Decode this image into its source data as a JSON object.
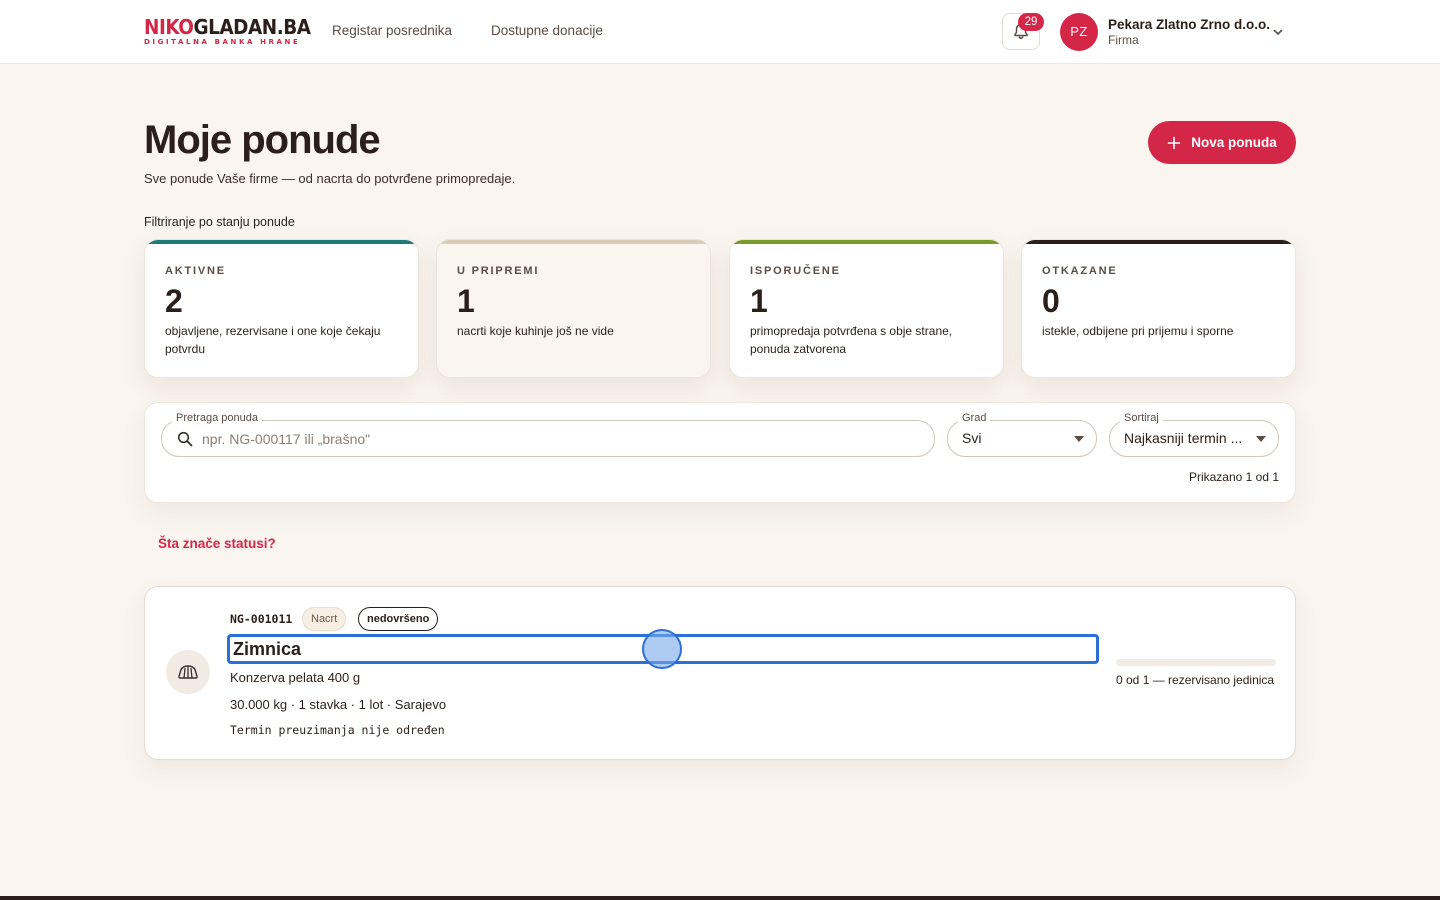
{
  "brand": {
    "logo_part1": "NIKO",
    "logo_part2": "GLADAN.BA",
    "tagline": "DIGITALNA BANKA HRANE"
  },
  "nav": {
    "items": [
      {
        "label": "Registar posrednika"
      },
      {
        "label": "Dostupne donacije"
      }
    ]
  },
  "notifications": {
    "count": "29"
  },
  "user": {
    "initials": "PZ",
    "name": "Pekara Zlatno Zrno d.o.o.",
    "role": "Firma"
  },
  "page": {
    "title": "Moje ponude",
    "subtitle": "Sve ponude Vaše firme — od nacrta do potvrđene primopredaje.",
    "new_offer_label": "Nova ponuda",
    "filter_label": "Filtriranje po stanju ponude"
  },
  "stats": [
    {
      "key": "AKTIVNE",
      "count": "2",
      "description": "objavljene, rezervisane i one koje čekaju potvrdu",
      "color": "#1f7a7a"
    },
    {
      "key": "U PRIPREMI",
      "count": "1",
      "description": "nacrti koje kuhinje još ne vide",
      "color": "#d9cbb8"
    },
    {
      "key": "ISPORUČENE",
      "count": "1",
      "description": "primopredaja potvrđena s obje strane, ponuda zatvorena",
      "color": "#7a9a2a"
    },
    {
      "key": "OTKAZANE",
      "count": "0",
      "description": "istekle, odbijene pri prijemu i sporne",
      "color": "#2a1f1a"
    }
  ],
  "search": {
    "legend": "Pretraga ponuda",
    "placeholder": "npr. NG-000117 ili „brašno\""
  },
  "city": {
    "legend": "Grad",
    "value": "Svi"
  },
  "sort": {
    "legend": "Sortiraj",
    "value": "Najkasniji termin ..."
  },
  "results": {
    "shown": "Prikazano 1 od 1"
  },
  "help": {
    "status_link": "Šta znače statusi?"
  },
  "offer": {
    "code": "NG-001011",
    "status_chip": "Nacrt",
    "completeness_chip": "nedovršeno",
    "title": "Zimnica",
    "product": "Konzerva pelata 400 g",
    "meta": "30.000 kg · 1 stavka · 1 lot · Sarajevo",
    "pickup": "Termin preuzimanja nije određen",
    "reserved_fraction": 0,
    "reserved_label": "0 od 1 — rezervisano jedinica"
  },
  "colors": {
    "accent": "#d42646",
    "focus": "#2c6fd8"
  }
}
